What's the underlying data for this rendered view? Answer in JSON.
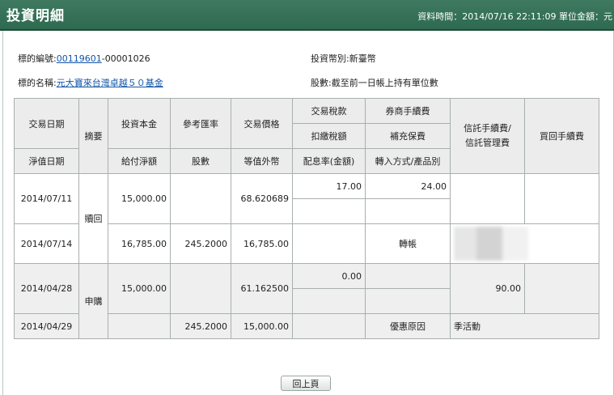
{
  "header": {
    "title": "投資明細",
    "meta": "資料時間：2014/07/16 22:11:09 單位金額：元"
  },
  "info": {
    "fund_code_label": "標的編號:",
    "fund_code_link": "00119601",
    "fund_code_suffix": "-00001026",
    "currency": "投資幣別:新臺幣",
    "fund_name_label": "標的名稱:",
    "fund_name_link": "元大寶來台灣卓越５０基金",
    "units_note": "股數:截至前一日帳上持有單位數"
  },
  "table": {
    "headers": {
      "trade_date": "交易日期",
      "summary": "摘要",
      "principal": "投資本金",
      "ref_rate": "參考匯率",
      "trade_price": "交易價格",
      "tax": "交易稅款",
      "broker_fee": "券商手續費",
      "trust_fee": "信託手續費/\n信託管理費",
      "redeem_fee": "買回手續費",
      "withholding": "扣繳稅額",
      "supplement": "補充保費",
      "nav_date": "淨值日期",
      "net_payment": "給付淨額",
      "units": "股數",
      "fx_value": "等值外幣",
      "dividend": "配息率(金額)",
      "transfer": "轉入方式/產品別"
    },
    "redeem": {
      "summary": "贖回",
      "trade_date": "2014/07/11",
      "principal": "15,000.00",
      "trade_price": "68.620689",
      "tax": "17.00",
      "broker_fee": "24.00",
      "nav_date": "2014/07/14",
      "net_payment": "16,785.00",
      "units": "245.2000",
      "fx_value": "16,785.00",
      "transfer": "轉帳"
    },
    "purchase": {
      "summary": "申購",
      "trade_date": "2014/04/28",
      "principal": "15,000.00",
      "trade_price": "61.162500",
      "tax": "0.00",
      "trust_fee": "90.00",
      "nav_date": "2014/04/29",
      "units": "245.2000",
      "fx_value": "15,000.00",
      "discount_label": "優惠原因",
      "discount_value": "季活動"
    }
  },
  "back_button": "回上頁"
}
